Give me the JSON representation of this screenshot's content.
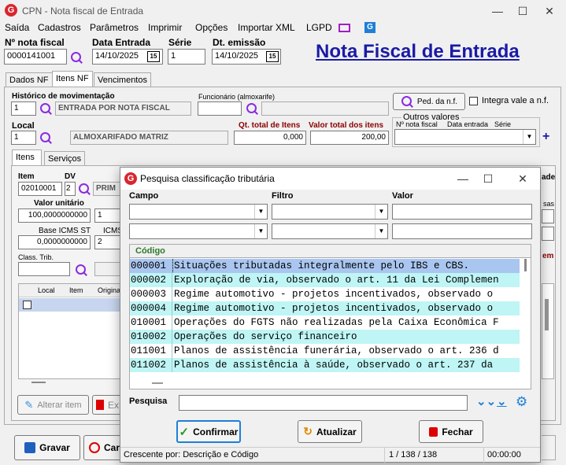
{
  "window": {
    "title": "CPN - Nota fiscal de Entrada",
    "icon_letter": "G"
  },
  "menu": [
    "Saída",
    "Cadastros",
    "Parâmetros",
    "Imprimir",
    "Opções",
    "Importar XML",
    "LGPD"
  ],
  "header": {
    "nota_fiscal_label": "Nº nota fiscal",
    "nota_fiscal": "0000141001",
    "data_entrada_label": "Data Entrada",
    "data_entrada": "14/10/2025",
    "serie_label": "Série",
    "serie": "1",
    "dt_emissao_label": "Dt. emissão",
    "dt_emissao": "14/10/2025",
    "big_title": "Nota Fiscal de Entrada",
    "cal_icon": "15"
  },
  "main_tabs": [
    "Dados NF",
    "Itens NF",
    "Vencimentos"
  ],
  "nf": {
    "historico_label": "Histórico de movimentação",
    "historico_code": "1",
    "historico_desc": "ENTRADA POR NOTA FISCAL",
    "funcionario_label": "Funcionário (almoxarife)",
    "ped_button": "Ped. da n.f.",
    "integra_label": "Integra vale a n.f.",
    "local_label": "Local",
    "local_code": "1",
    "local_desc": "ALMOXARIFADO MATRIZ",
    "qt_total_label": "Qt. total de Itens",
    "qt_total": "0,000",
    "valor_total_label": "Valor total dos itens",
    "valor_total": "200,00",
    "outros_label": "Outros valores",
    "outros_nf_label": "Nº nota fiscal",
    "outros_data_label": "Data entrada",
    "outros_serie_label": "Série"
  },
  "sub_tabs": [
    "Itens",
    "Serviços"
  ],
  "item": {
    "item_label": "Item",
    "item_code": "02010001",
    "dv_label": "DV",
    "dv_value": "2",
    "dv_desc": "PRIM",
    "valor_unit_label": "Valor unitário",
    "valor_unit": "100,0000000000",
    "base_icms_label": "Base ICMS ST",
    "base_icms": "0,0000000000",
    "icms_label": "ICMS",
    "class_trib_label": "Class. Trib.",
    "partial_1": "1",
    "partial_2": "2",
    "col_local": "Local",
    "col_item": "Item",
    "col_original": "Origina",
    "right_cut_1": "ade",
    "right_cut_2": "sas",
    "right_cut_3": "em",
    "alterar_button": "Alterar item",
    "excluir_button": "Ex"
  },
  "footer_buttons": {
    "gravar": "Gravar",
    "cancelar": "Car"
  },
  "dialog": {
    "title": "Pesquisa classificação tributária",
    "campo_label": "Campo",
    "filtro_label": "Filtro",
    "valor_label": "Valor",
    "grid_header": "Código",
    "rows": [
      {
        "code": "000001",
        "desc": "Situações tributadas integralmente pelo IBS e CBS."
      },
      {
        "code": "000002",
        "desc": "Exploração de via, observado o art. 11 da Lei Complemen"
      },
      {
        "code": "000003",
        "desc": "Regime automotivo - projetos incentivados, observado o"
      },
      {
        "code": "000004",
        "desc": "Regime automotivo - projetos incentivados, observado o"
      },
      {
        "code": "010001",
        "desc": "Operações do FGTS não realizadas pela Caixa Econômica F"
      },
      {
        "code": "010002",
        "desc": "Operações do serviço financeiro"
      },
      {
        "code": "011001",
        "desc": "Planos de assistência funerária, observado o art. 236 d"
      },
      {
        "code": "011002",
        "desc": "Planos de assistência à saúde, observado o art. 237 da"
      }
    ],
    "pesquisa_label": "Pesquisa",
    "confirmar": "Confirmar",
    "atualizar": "Atualizar",
    "fechar": "Fechar",
    "status_sort": "Crescente por: Descrição e Código",
    "status_count": "1 / 138 / 138",
    "status_time": "00:00:00"
  },
  "colors": {
    "accent": "#1a1aa6",
    "brand": "#d9262e",
    "row_selected": "#a9c6f0",
    "row_cyan": "#bff5f5",
    "label_red": "#8b0000"
  }
}
